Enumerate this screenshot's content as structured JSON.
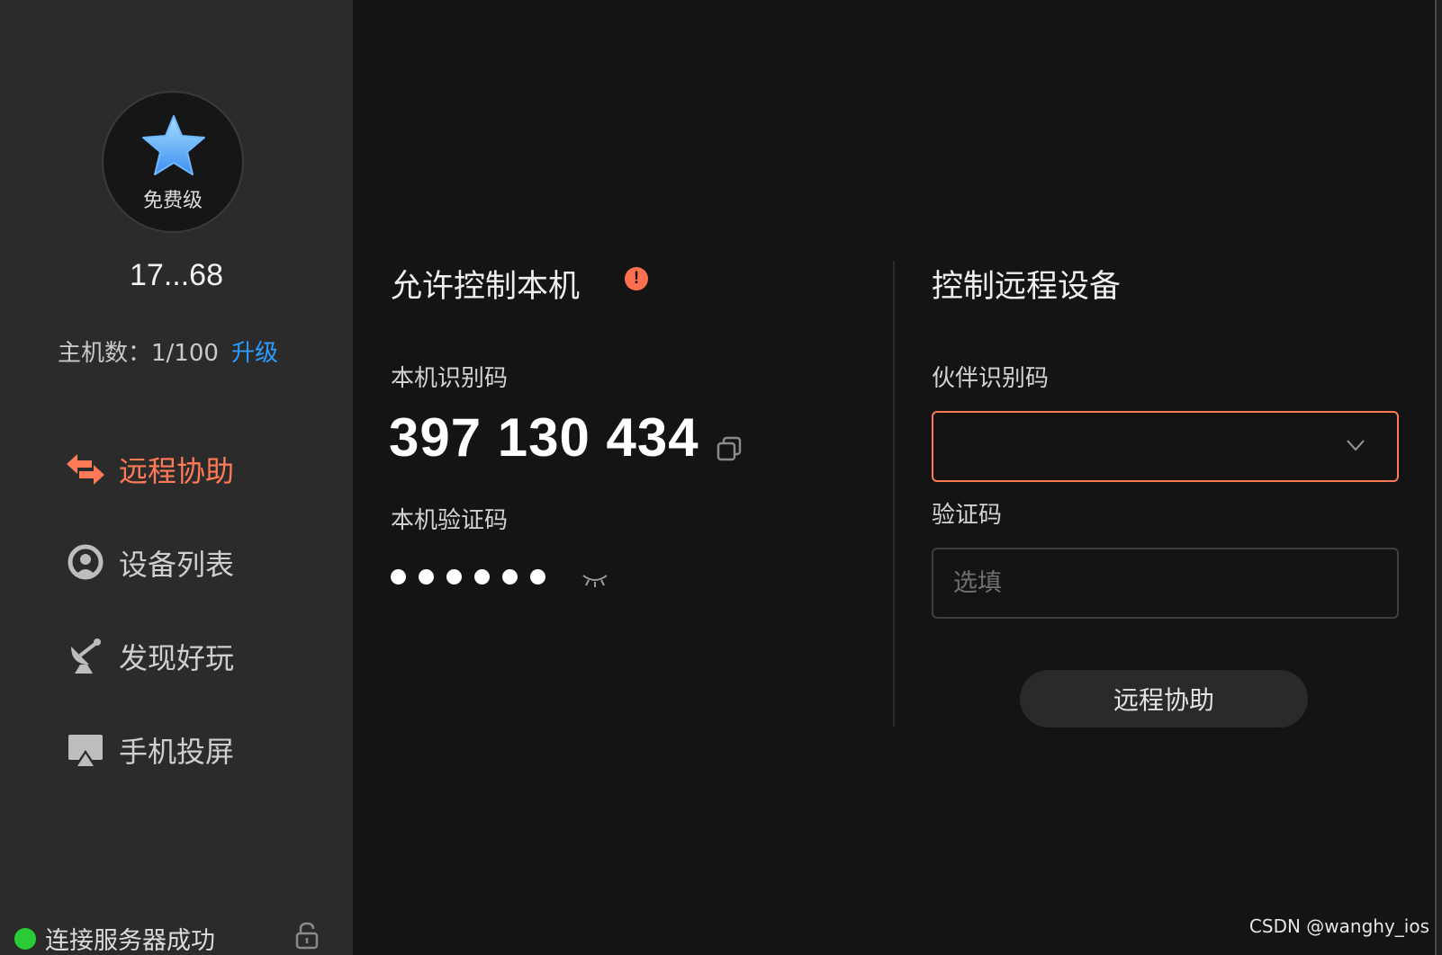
{
  "window": {
    "controls": [
      "close",
      "minimize",
      "maximize"
    ]
  },
  "sidebar": {
    "plan_label": "免费级",
    "account_id": "17...68",
    "host_count_label": "主机数：1/100",
    "upgrade_label": "升级",
    "nav": [
      {
        "label": "远程协助",
        "icon": "remote-assist-icon",
        "active": true
      },
      {
        "label": "设备列表",
        "icon": "device-list-icon",
        "active": false
      },
      {
        "label": "发现好玩",
        "icon": "discover-icon",
        "active": false
      },
      {
        "label": "手机投屏",
        "icon": "screen-cast-icon",
        "active": false
      }
    ],
    "status_text": "连接服务器成功"
  },
  "allow_control": {
    "title": "允许控制本机",
    "device_id_label": "本机识别码",
    "device_id": "397 130 434",
    "verify_code_label": "本机验证码",
    "verify_code_masked_length": 6
  },
  "remote_control": {
    "title": "控制远程设备",
    "partner_id_label": "伙伴识别码",
    "partner_id_value": "",
    "code_label": "验证码",
    "code_placeholder": "选填",
    "connect_button": "远程协助"
  },
  "watermark": "CSDN @wanghy_ios",
  "colors": {
    "accent": "#ff7a55",
    "link": "#2f9bff",
    "status_ok": "#2bcb36",
    "sidebar_bg": "#2b2b2b",
    "main_bg": "#141414"
  }
}
